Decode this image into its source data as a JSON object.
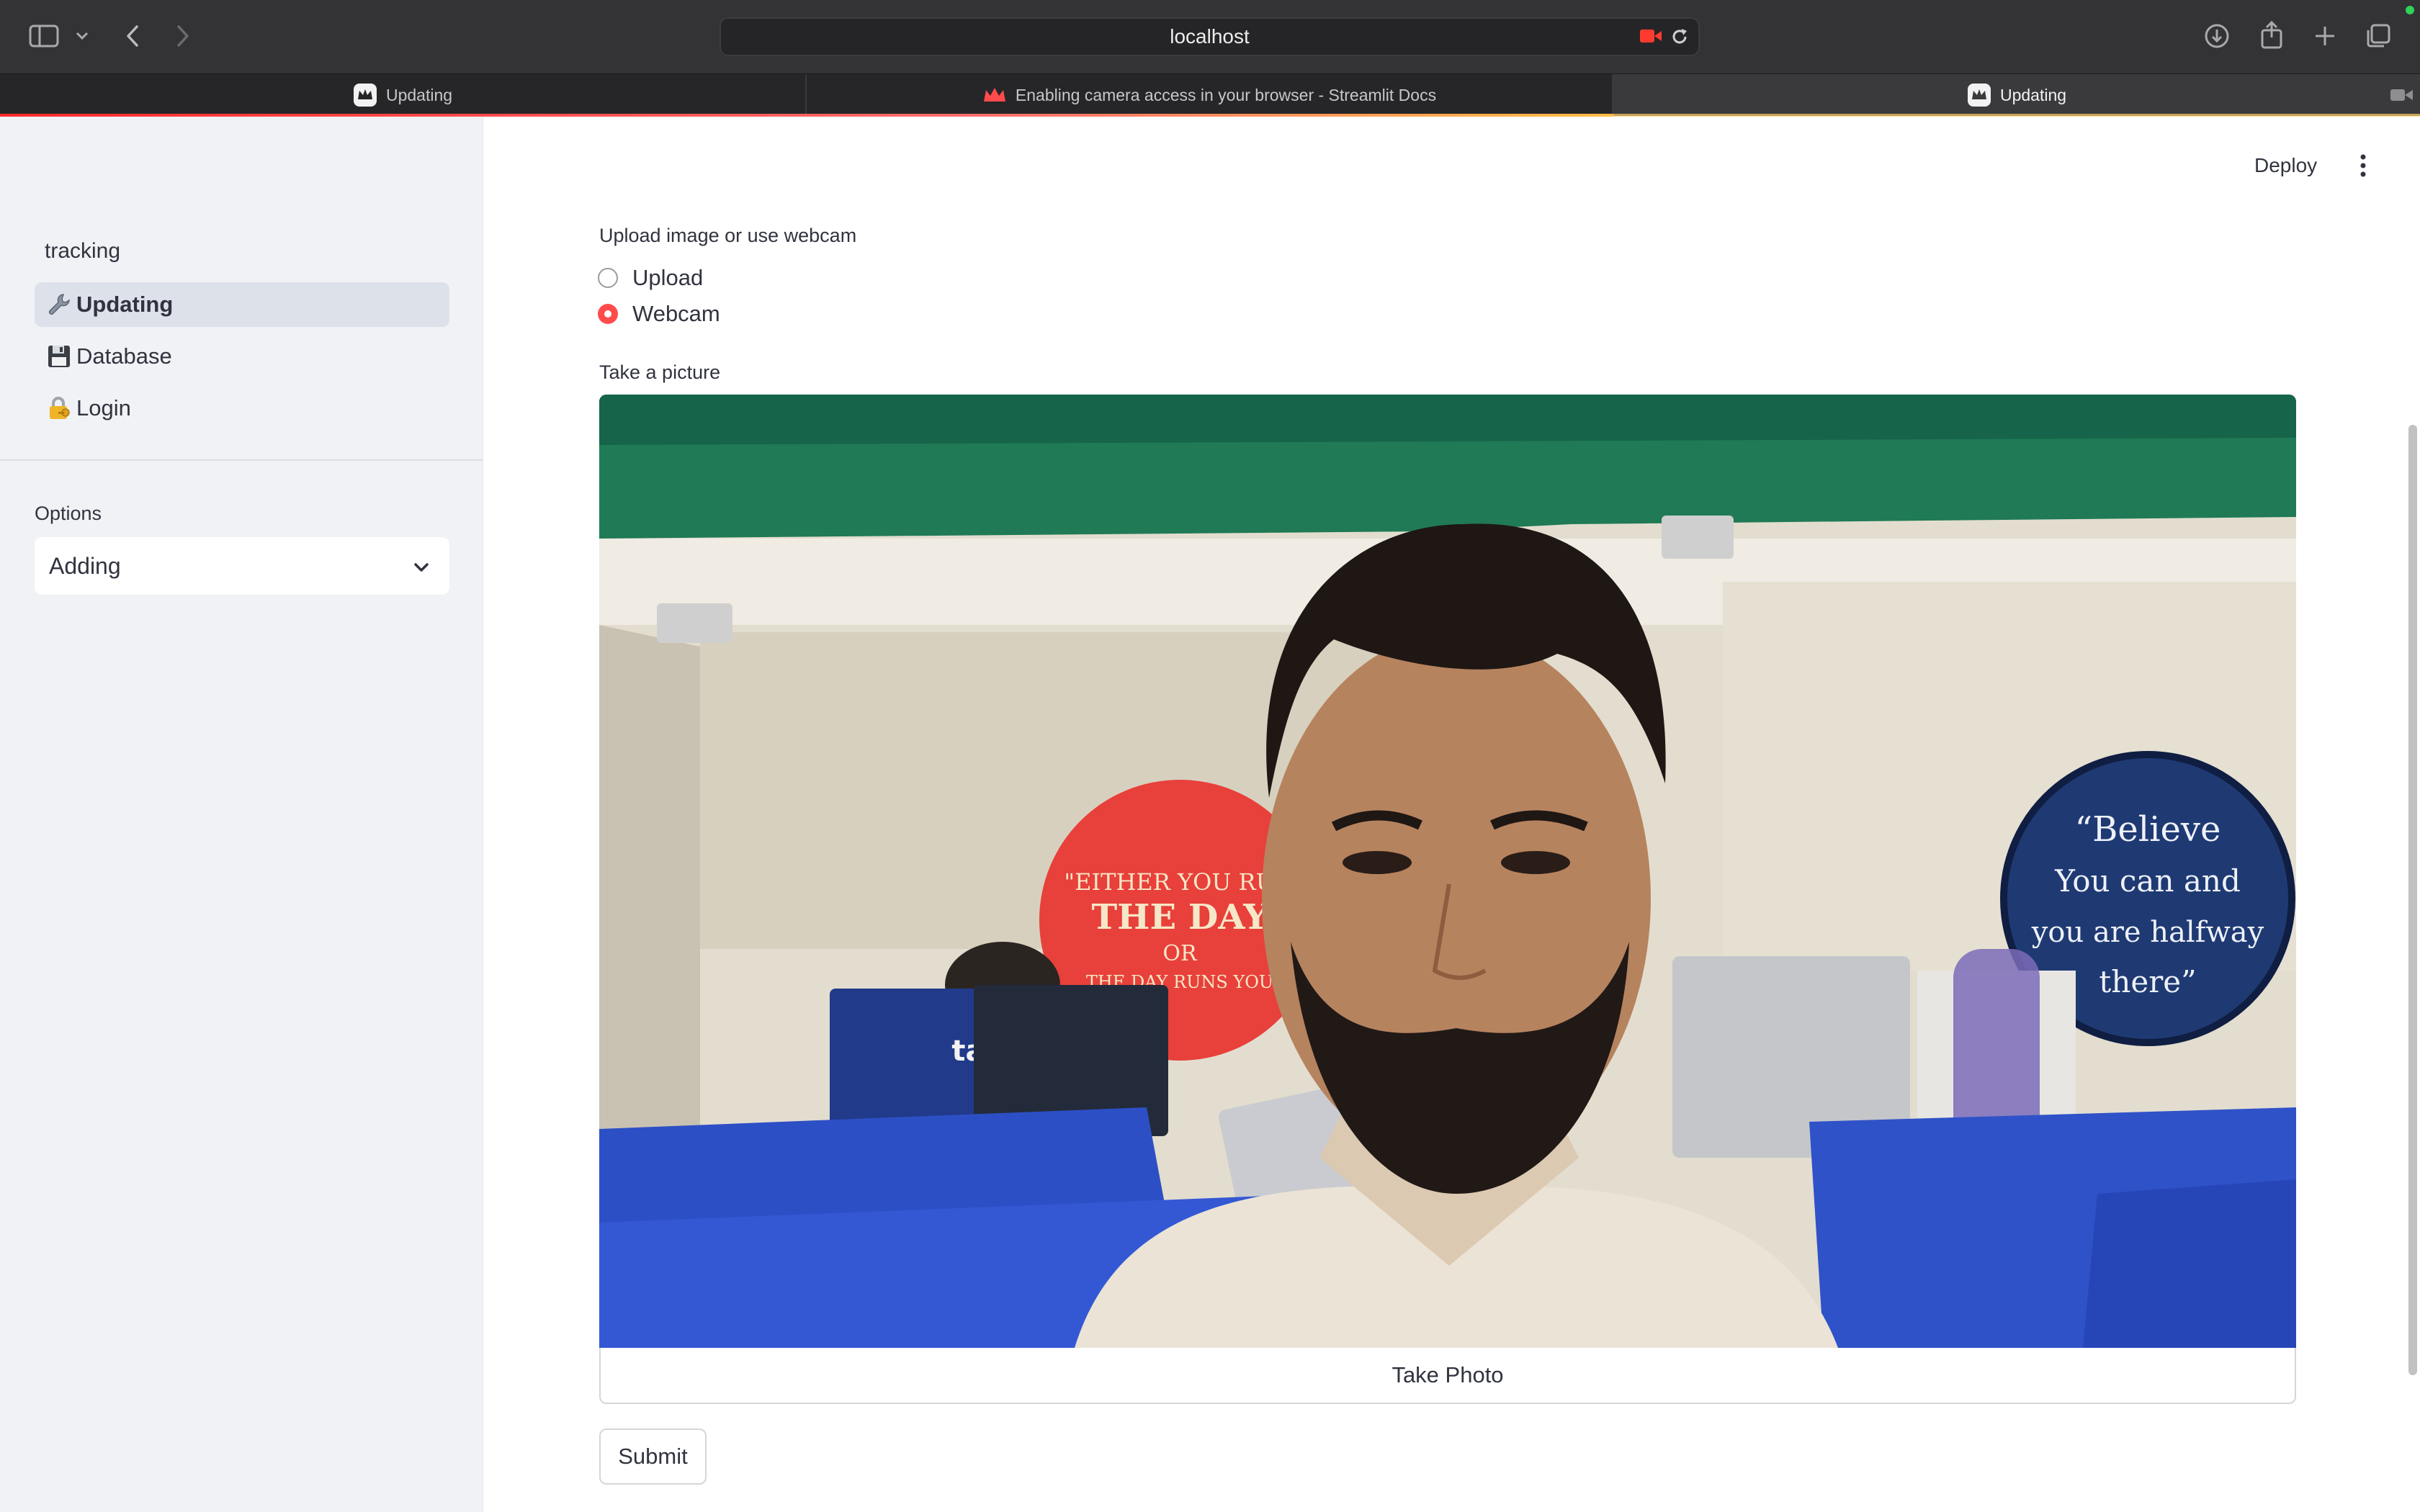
{
  "browser": {
    "url": "localhost",
    "tabs": [
      {
        "label": "Updating",
        "favicon": "streamlit-crown-icon",
        "active": false
      },
      {
        "label": "Enabling camera access in your browser - Streamlit Docs",
        "favicon": "streamlit-red-crown-icon",
        "active": false
      },
      {
        "label": "Updating",
        "favicon": "streamlit-crown-icon",
        "active": true
      }
    ],
    "toolbar_icons": [
      "sidebar-toggle-icon",
      "chevron-down-icon",
      "back-icon",
      "forward-icon",
      "download-icon",
      "share-icon",
      "new-tab-icon",
      "tab-overview-icon"
    ],
    "recording_indicator_color": "#ff3b30"
  },
  "sidebar": {
    "app_title": "tracking",
    "nav_items": [
      {
        "emoji": "🔧",
        "label": "Updating",
        "active": true
      },
      {
        "emoji": "💾",
        "label": "Database",
        "active": false
      },
      {
        "emoji": "🔐",
        "label": "Login",
        "active": false
      }
    ],
    "options_label": "Options",
    "options_value": "Adding"
  },
  "header": {
    "deploy_label": "Deploy",
    "menu_icon": "kebab-menu-icon"
  },
  "main": {
    "source_label": "Upload image or use webcam",
    "radio_options": [
      {
        "label": "Upload",
        "selected": false
      },
      {
        "label": "Webcam",
        "selected": true
      }
    ],
    "camera_label": "Take a picture",
    "take_photo_label": "Take Photo",
    "submit_label": "Submit",
    "accent_color": "#ff4b4b"
  },
  "webcam_scene": {
    "poster_left": [
      "\"EITHER YOU RUN",
      "THE DAY",
      "OR",
      "THE DAY RUNS YOU"
    ],
    "poster_right": [
      "“Believe",
      "You can and",
      "you are halfway",
      "there”"
    ],
    "laptop_sticker": "tank"
  }
}
